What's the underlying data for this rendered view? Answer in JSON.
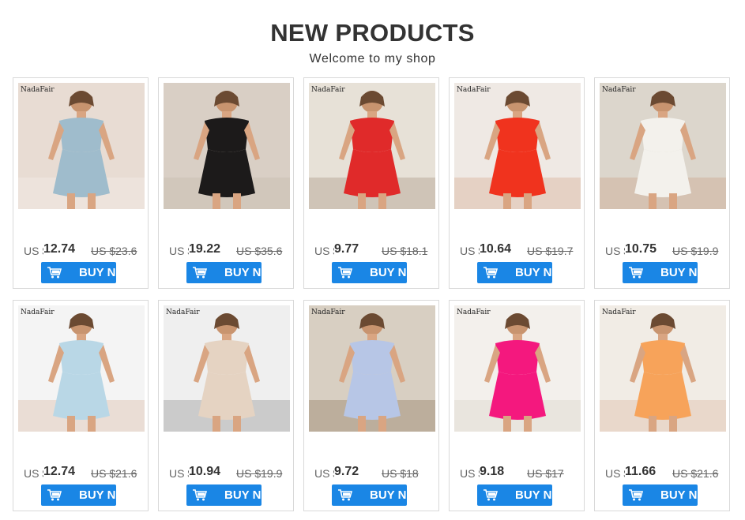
{
  "header": {
    "title": "NEW PRODUCTS",
    "subtitle": "Welcome to my shop"
  },
  "buy_label": "BUY N",
  "currency": "US $",
  "products": [
    {
      "brand": "NadaFair",
      "price": "12.74",
      "old_price": "US $23.6",
      "image": "blue lace backless mini dress",
      "colors": [
        "#9fbccc",
        "#e8dcd3",
        "#f5f2ee"
      ]
    },
    {
      "brand": "",
      "price": "19.22",
      "old_price": "US $35.6",
      "image": "black lace open back dress",
      "colors": [
        "#1c1a1a",
        "#d9cfc5",
        "#c4b7aa"
      ]
    },
    {
      "brand": "NadaFair",
      "price": "9.77",
      "old_price": "US $18.1",
      "image": "red ruched backless dress",
      "colors": [
        "#e02a2a",
        "#e7e1d7",
        "#a38e7a"
      ]
    },
    {
      "brand": "NadaFair",
      "price": "10.64",
      "old_price": "US $19.7",
      "image": "red wrap slip dress",
      "colors": [
        "#f0331e",
        "#efe9e4",
        "#d4a68a"
      ]
    },
    {
      "brand": "NadaFair",
      "price": "10.75",
      "old_price": "US $19.9",
      "image": "white square neck bodycon dress",
      "colors": [
        "#f3f1ec",
        "#dcd6cc",
        "#c99d80"
      ]
    },
    {
      "brand": "NadaFair",
      "price": "12.74",
      "old_price": "US $21.6",
      "image": "light blue off shoulder tie dress",
      "colors": [
        "#b9d7e6",
        "#f4f4f4",
        "#d7b19a"
      ]
    },
    {
      "brand": "NadaFair",
      "price": "10.94",
      "old_price": "US $19.9",
      "image": "beige ruffle hem t-shirt dress",
      "colors": [
        "#e5d3c2",
        "#efefef",
        "#8a8a8a"
      ]
    },
    {
      "brand": "NadaFair",
      "price": "9.72",
      "old_price": "US $18",
      "image": "light blue short sleeve bodycon dress",
      "colors": [
        "#b7c6e6",
        "#d8cfc2",
        "#8a6f55"
      ]
    },
    {
      "brand": "NadaFair",
      "price": "9.18",
      "old_price": "US $17",
      "image": "pink bodycon dress with white cardigan",
      "colors": [
        "#f4187e",
        "#f3f0ec",
        "#d7d0c6"
      ]
    },
    {
      "brand": "NadaFair",
      "price": "11.66",
      "old_price": "US $21.6",
      "image": "orange halter crop top and skirt set",
      "colors": [
        "#f7a35a",
        "#f1ece5",
        "#d9b59a"
      ]
    }
  ]
}
